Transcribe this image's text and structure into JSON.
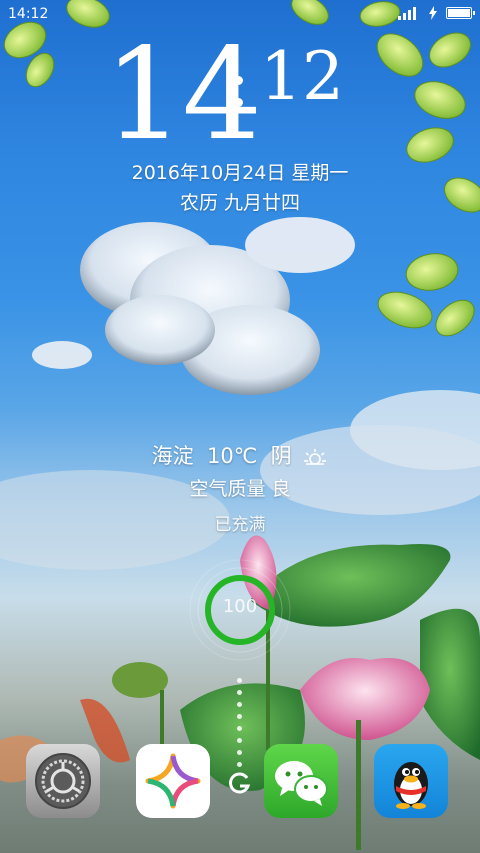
{
  "status_bar": {
    "time": "14:12",
    "battery_level": 1.0
  },
  "clock": {
    "hours": "14",
    "minutes": "12"
  },
  "date": {
    "gregorian": "2016年10月24日 星期一",
    "lunar": "农历  九月廿四"
  },
  "weather": {
    "location": "海淀",
    "temperature": "10℃",
    "condition": "阴",
    "condition_icon": "cloudy-sun-icon",
    "air_quality": "空气质量  良"
  },
  "charging": {
    "status": "已充满",
    "percent": "100",
    "ring_color": "#25b526"
  },
  "dock": {
    "apps": [
      {
        "name": "settings",
        "icon": "settings-gear-icon"
      },
      {
        "name": "pattern",
        "icon": "colorful-star-icon"
      },
      {
        "name": "wechat",
        "icon": "wechat-icon"
      },
      {
        "name": "qq",
        "icon": "qq-penguin-icon"
      }
    ],
    "center_icon": "unlock-g-icon"
  }
}
